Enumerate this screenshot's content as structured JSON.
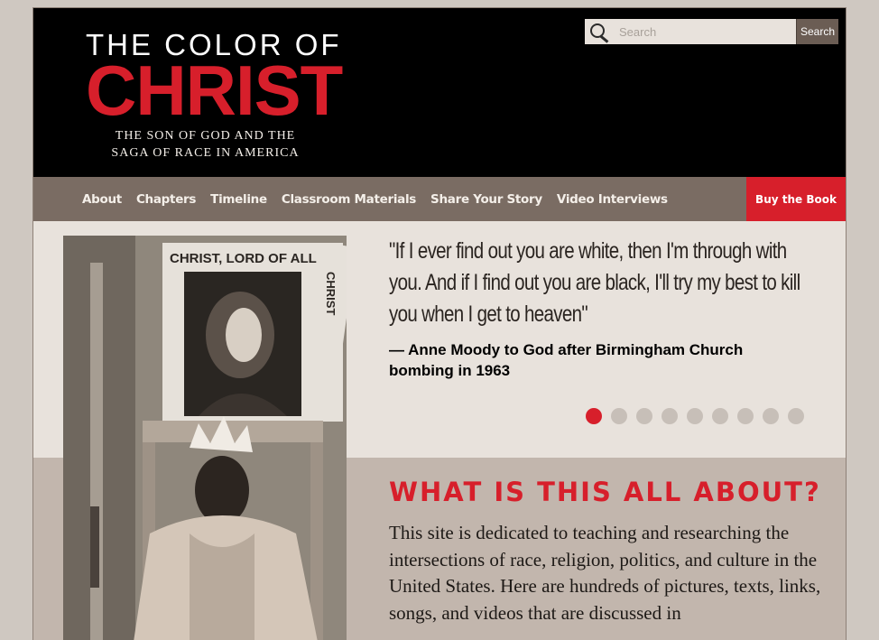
{
  "header": {
    "logo_line1": "THE COLOR OF",
    "logo_line2": "CHRIST",
    "logo_sub1": "THE SON OF GOD AND THE",
    "logo_sub2": "SAGA OF RACE IN AMERICA"
  },
  "search": {
    "placeholder": "Search",
    "button_label": "Search"
  },
  "nav": {
    "items": [
      {
        "label": "About"
      },
      {
        "label": "Chapters"
      },
      {
        "label": "Timeline"
      },
      {
        "label": "Classroom Materials"
      },
      {
        "label": "Share Your Story"
      },
      {
        "label": "Video Interviews"
      }
    ],
    "buy_label": "Buy the Book"
  },
  "feature": {
    "photo_sign_text1": "CHRIST, LORD OF ALL",
    "photo_sign_text2": "CHRIST",
    "quote": "\"If I ever find out you are white, then I'm through with you. And if I find out you are black, I'll try my best to kill you when I get to heaven\"",
    "attribution": "— Anne Moody to God after Birmingham Church bombing in 1963",
    "slide_count": 9,
    "active_slide": 1
  },
  "about": {
    "title": "WHAT IS THIS ALL ABOUT?",
    "body": "This site is dedicated to teaching and researching the intersections of race, religion, politics, and culture in the United States. Here are hundreds of pictures, texts, links, songs, and videos that are discussed in"
  },
  "colors": {
    "accent": "#d71f2b",
    "nav_bg": "#7a6c63",
    "header_bg": "#000000",
    "page_bg": "#e8e2dc"
  }
}
